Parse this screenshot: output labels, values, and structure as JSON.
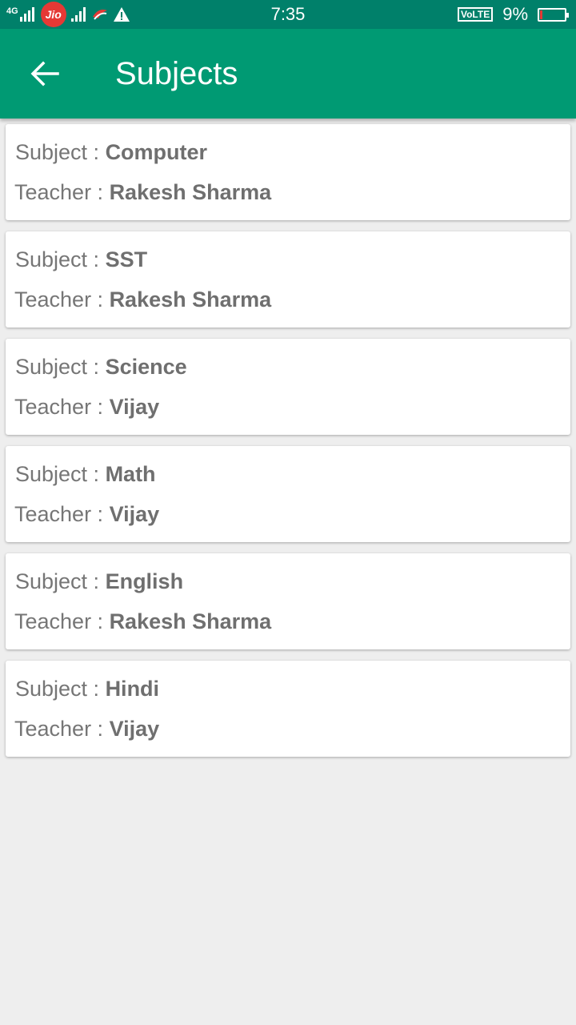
{
  "status_bar": {
    "network_type": "4G",
    "carrier_logo": "Jio",
    "time": "7:35",
    "volte": "VoLTE",
    "battery_percent": "9%",
    "battery_level": 0.09,
    "icons": [
      "signal-icon",
      "jio-logo",
      "signal-icon",
      "airtel-icon",
      "warning-icon",
      "battery-icon"
    ]
  },
  "app_bar": {
    "title": "Subjects",
    "back_icon": "arrow-back-icon",
    "color": "#009a73"
  },
  "labels": {
    "subject": "Subject : ",
    "teacher": "Teacher : "
  },
  "subjects": [
    {
      "subject": "Computer",
      "teacher": "Rakesh Sharma"
    },
    {
      "subject": "SST",
      "teacher": "Rakesh Sharma"
    },
    {
      "subject": "Science",
      "teacher": "Vijay"
    },
    {
      "subject": "Math",
      "teacher": "Vijay"
    },
    {
      "subject": "English",
      "teacher": "Rakesh Sharma"
    },
    {
      "subject": "Hindi",
      "teacher": "Vijay"
    }
  ]
}
